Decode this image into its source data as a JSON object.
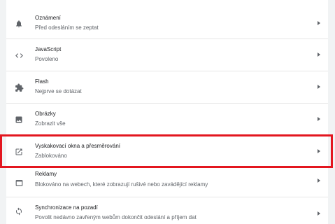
{
  "settings": {
    "rows": [
      {
        "title": "Oznámení",
        "subtitle": "Před odesláním se zeptat",
        "icon": "bell-icon"
      },
      {
        "title": "JavaScript",
        "subtitle": "Povoleno",
        "icon": "code-icon"
      },
      {
        "title": "Flash",
        "subtitle": "Nejprve se dotázat",
        "icon": "puzzle-icon"
      },
      {
        "title": "Obrázky",
        "subtitle": "Zobrazit vše",
        "icon": "image-icon"
      },
      {
        "title": "Vyskakovací okna a přesměrování",
        "subtitle": "Zablokováno",
        "icon": "open-in-new-icon"
      },
      {
        "title": "Reklamy",
        "subtitle": "Blokováno na webech, které zobrazují rušivé nebo zavádějící reklamy",
        "icon": "ads-icon"
      },
      {
        "title": "Synchronizace na pozadí",
        "subtitle": "Povolit nedávno zavřeným webům dokončit odeslání a příjem dat",
        "icon": "sync-icon"
      }
    ]
  },
  "colors": {
    "highlight": "#e3161f",
    "icon": "#5f6368",
    "text_primary": "#202124",
    "text_secondary": "#5f6368"
  }
}
